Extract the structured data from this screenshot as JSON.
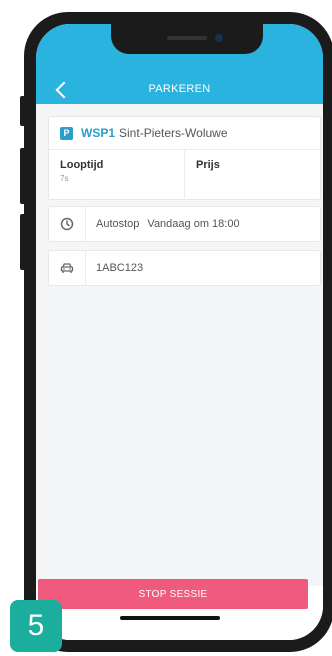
{
  "header": {
    "title": "PARKEREN",
    "back_icon": "chevron-left-icon"
  },
  "zone": {
    "badge": "P",
    "code": "WSP1",
    "name": "Sint-Pieters-Woluwe"
  },
  "duration": {
    "label": "Looptijd",
    "value": "7s"
  },
  "price": {
    "label": "Prijs",
    "value": ""
  },
  "autostop": {
    "label": "Autostop",
    "value": "Vandaag om 18:00",
    "icon": "clock-icon"
  },
  "vehicle": {
    "plate": "1ABC123",
    "icon": "car-icon"
  },
  "stop_button": {
    "label": "STOP SESSIE"
  },
  "step_badge": {
    "number": "5"
  },
  "colors": {
    "header": "#2bb3e0",
    "stop_button": "#f05a7e",
    "step_badge": "#1cae9d",
    "accent": "#2a9fc9"
  }
}
